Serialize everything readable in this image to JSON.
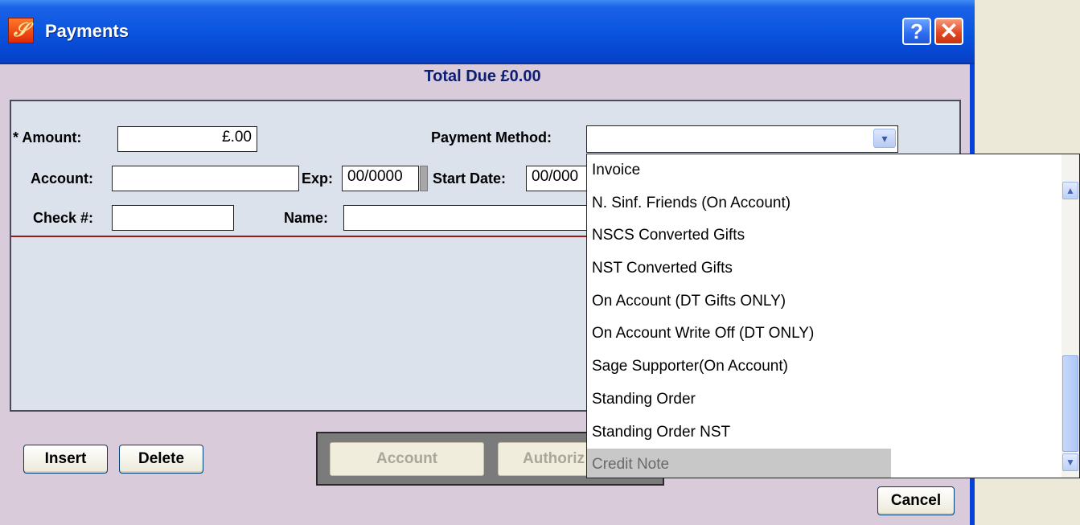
{
  "window": {
    "title": "Payments",
    "app_icon_letter": "𝒮",
    "help_label": "?",
    "close_label": "✕"
  },
  "total_due": "Total Due £0.00",
  "form": {
    "amount_label": "* Amount:",
    "amount_value": "£.00",
    "payment_method_label": "Payment Method:",
    "payment_method_value": "",
    "account_label": "Account:",
    "account_value": "",
    "exp_label": "Exp:",
    "exp_value": "00/0000",
    "start_date_label": "Start Date:",
    "start_date_value": "00/000",
    "check_label": "Check #:",
    "check_value": "",
    "name_label": "Name:",
    "name_value": ""
  },
  "buttons": {
    "insert": "Insert",
    "delete": "Delete",
    "account": "Account",
    "authorize": "Authoriz",
    "cancel": "Cancel"
  },
  "dropdown": {
    "items": [
      "Invoice",
      "N. Sinf. Friends (On Account)",
      "NSCS Converted Gifts",
      "NST Converted Gifts",
      "On Account (DT Gifts ONLY)",
      "On Account Write Off (DT ONLY)",
      "Sage Supporter(On Account)",
      "Standing Order",
      "Standing Order NST",
      "Credit Note"
    ],
    "highlighted": "Credit Note"
  },
  "icons": {
    "select_arrow": "▾",
    "scroll_up": "▲",
    "scroll_down": "▼"
  },
  "colors": {
    "titlebar": "#0a55e0",
    "window_bg": "#d9cbd9",
    "panel_bg": "#dbe2ec",
    "total_due_text": "#0a1e74",
    "divider": "#9a1b1b"
  }
}
